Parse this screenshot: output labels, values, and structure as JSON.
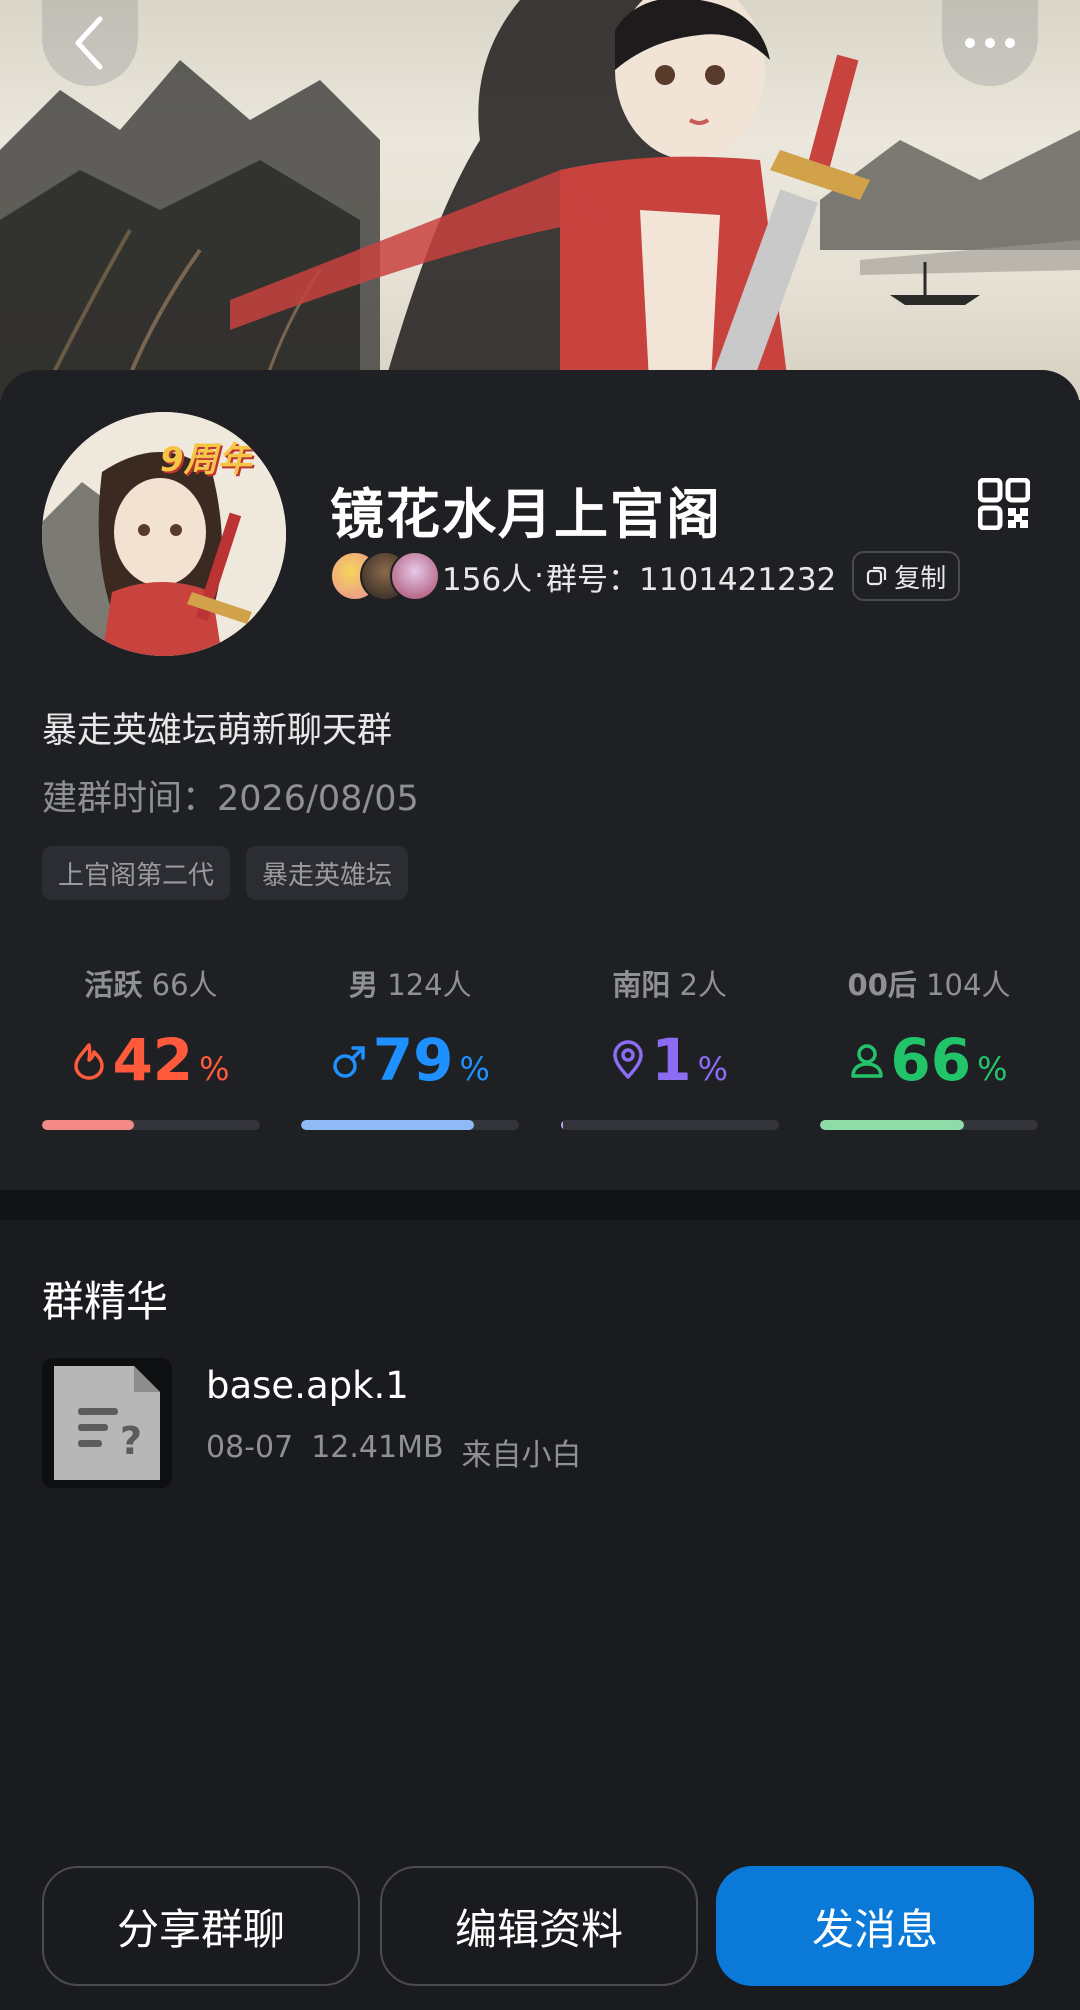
{
  "header": {
    "back_icon": "chevron-left-icon",
    "more_icon": "more-horizontal-icon"
  },
  "group": {
    "name": "镜花水月上官阁",
    "avatar_badge": "9周年",
    "member_count": "156人",
    "separator": "·",
    "group_id_label": "群号：1101421232",
    "copy_label": "复制",
    "description": "暴走英雄坛萌新聊天群",
    "created": "建群时间：2026/08/05",
    "tags": [
      "上官阁第二代",
      "暴走英雄坛"
    ]
  },
  "stats": [
    {
      "label": "活跃",
      "count": "66人",
      "value": "42",
      "unit": "%",
      "fraction": 0.42,
      "color": "#ff5a3c",
      "bar_color": "#f48a88",
      "icon": "flame-icon"
    },
    {
      "label": "男",
      "count": "124人",
      "value": "79",
      "unit": "%",
      "fraction": 0.79,
      "color": "#1e90ff",
      "bar_color": "#8fbaf5",
      "icon": "male-icon"
    },
    {
      "label": "南阳",
      "count": "2人",
      "value": "1",
      "unit": "%",
      "fraction": 0.01,
      "color": "#8b6cf2",
      "bar_color": "#b8a8f6",
      "icon": "location-pin-icon"
    },
    {
      "label": "00后",
      "count": "104人",
      "value": "66",
      "unit": "%",
      "fraction": 0.66,
      "color": "#22c46a",
      "bar_color": "#8fdca8",
      "icon": "person-icon"
    }
  ],
  "essence": {
    "title": "群精华",
    "file_name": "base.apk.1",
    "file_date": "08-07",
    "file_size": "12.41MB",
    "file_from": "来自小白"
  },
  "actions": {
    "share": "分享群聊",
    "edit": "编辑资料",
    "send": "发消息"
  },
  "colors": {
    "accent": "#0a79d8",
    "background": "#1a1b1f",
    "card": "#1f2024"
  }
}
